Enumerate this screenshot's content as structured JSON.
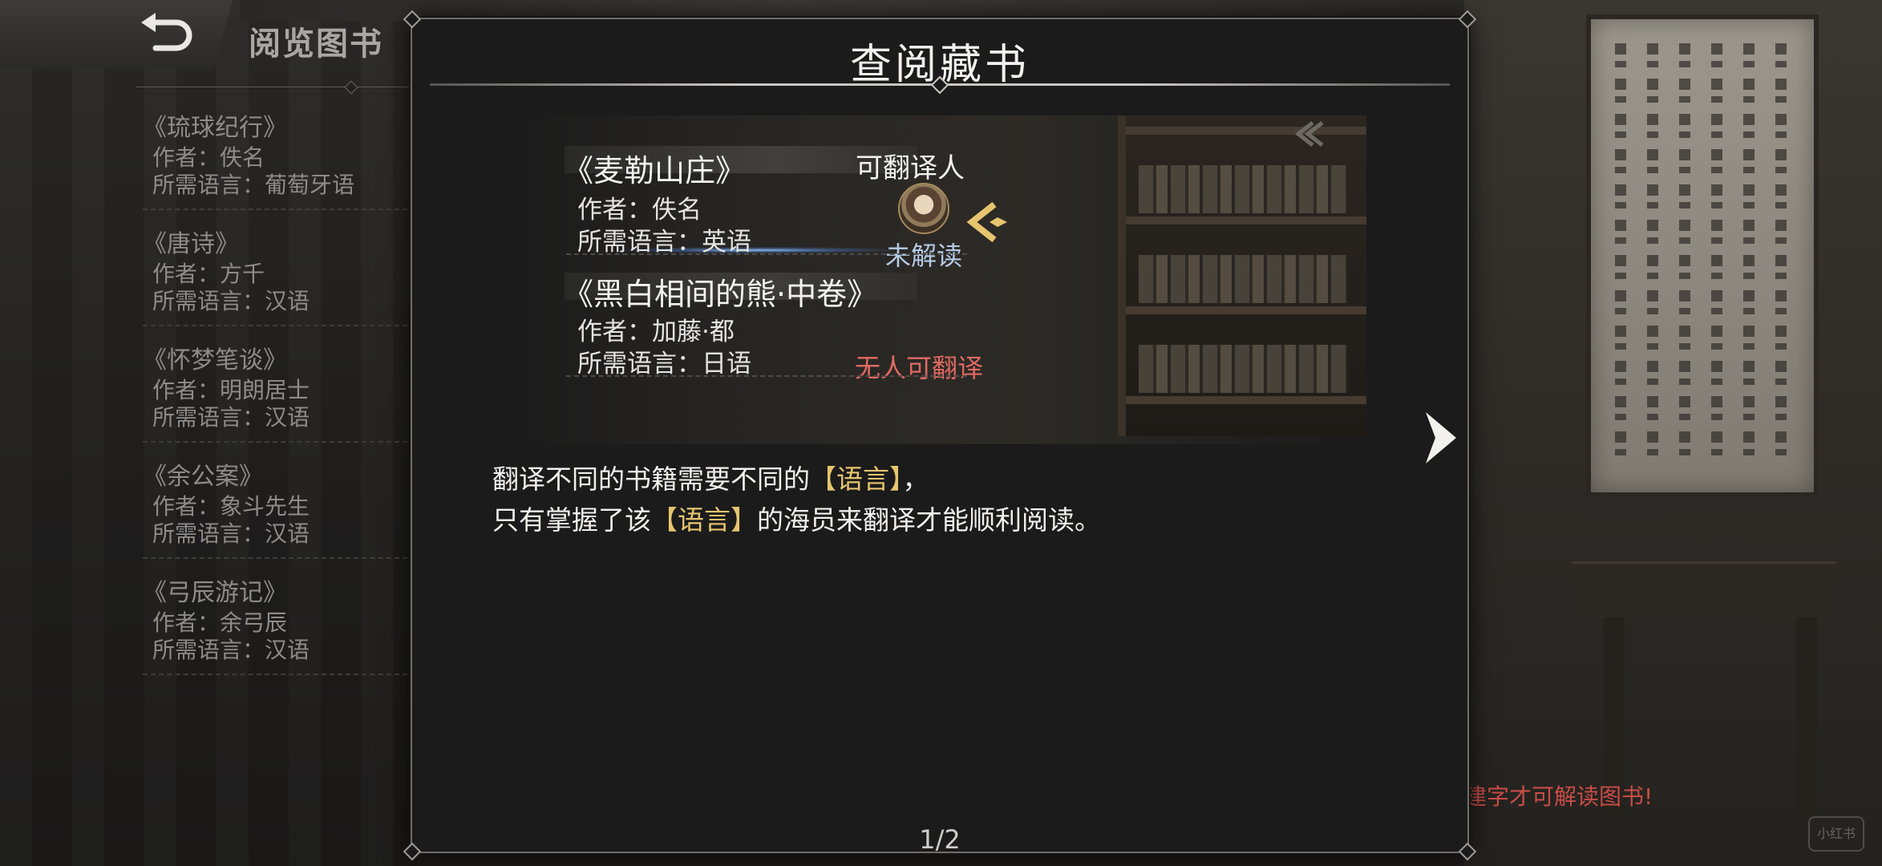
{
  "header": {
    "back_icon": "back-arrow-icon",
    "title": "阅览图书"
  },
  "sidebar": {
    "books": [
      {
        "title": "《琉球纪行》",
        "author": "作者：佚名",
        "language": "所需语言：葡萄牙语"
      },
      {
        "title": "《唐诗》",
        "author": "作者：方千",
        "language": "所需语言：汉语"
      },
      {
        "title": "《怀梦笔谈》",
        "author": "作者：明朗居士",
        "language": "所需语言：汉语"
      },
      {
        "title": "《余公案》",
        "author": "作者：象斗先生",
        "language": "所需语言：汉语"
      },
      {
        "title": "《弓辰游记》",
        "author": "作者：余弓辰",
        "language": "所需语言：汉语"
      }
    ]
  },
  "dialog": {
    "title": "查阅藏书",
    "translator_header": "可翻译人",
    "example_books": [
      {
        "title": "《麦勒山庄》",
        "author": "作者：佚名",
        "language": "所需语言：英语",
        "status": "未解读",
        "status_color": "#b5cbe6"
      },
      {
        "title": "《黑白相间的熊·中卷》",
        "author": "作者：加藤·都",
        "language": "所需语言：日语",
        "status": "无人可翻译",
        "status_color": "#e06a63"
      }
    ],
    "description": {
      "line1_pre": "翻译不同的书籍需要不同的",
      "line1_hl": "【语言】",
      "line1_post": "，",
      "line2_pre": "只有掌握了该",
      "line2_hl": "【语言】",
      "line2_post": "的海员来翻译才能顺利阅读。"
    },
    "highlight_color": "#e7c46f",
    "page_indicator": "1/2",
    "next_icon": "next-page-arrow-icon"
  },
  "background_hint": "建字才可解读图书!",
  "watermark": "小红书"
}
